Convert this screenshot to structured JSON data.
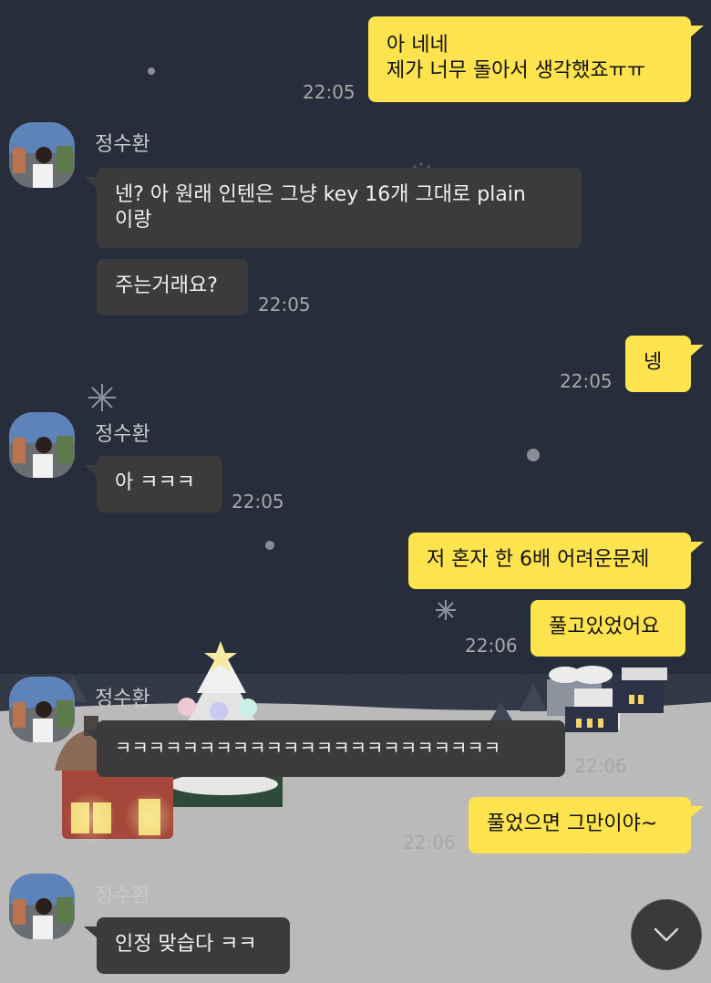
{
  "messages": [
    {
      "from": "me",
      "lines": [
        "아 네네",
        "제가 너무 돌아서 생각했죠ㅠㅠ"
      ],
      "time": "22:05"
    },
    {
      "from": "them",
      "sender": "정수환",
      "lines": [
        "넨? 아 원래 인텐은 그냥 key 16개 그대로 plain",
        "이랑"
      ]
    },
    {
      "from": "them",
      "lines": [
        "주는거래요?"
      ],
      "time": "22:05"
    },
    {
      "from": "me",
      "lines": [
        "넹"
      ],
      "time": "22:05"
    },
    {
      "from": "them",
      "sender": "정수환",
      "lines": [
        "아 ㅋㅋㅋ"
      ],
      "time": "22:05"
    },
    {
      "from": "me",
      "lines": [
        "저 혼자 한 6배 어려운문제"
      ]
    },
    {
      "from": "me",
      "lines": [
        "풀고있었어요"
      ],
      "time": "22:06"
    },
    {
      "from": "them",
      "sender": "정수환",
      "lines": [
        "ㅋㅋㅋㅋㅋㅋㅋㅋㅋㅋㅋㅋㅋㅋㅋㅋㅋㅋㅋㅋㅋㅋㅋ"
      ],
      "time": "22:06"
    },
    {
      "from": "me",
      "lines": [
        "풀었으면 그만이야~"
      ],
      "time": "22:06"
    },
    {
      "from": "them",
      "sender": "정수환",
      "lines": [
        "인정 맞습다 ㅋㅋ"
      ]
    }
  ],
  "icons": {
    "scroll_down": "chevron-down-icon",
    "avatar": "avatar"
  },
  "colors": {
    "background": "#272d3b",
    "my_bubble": "#fde34e",
    "their_bubble": "#3b3b3b"
  }
}
